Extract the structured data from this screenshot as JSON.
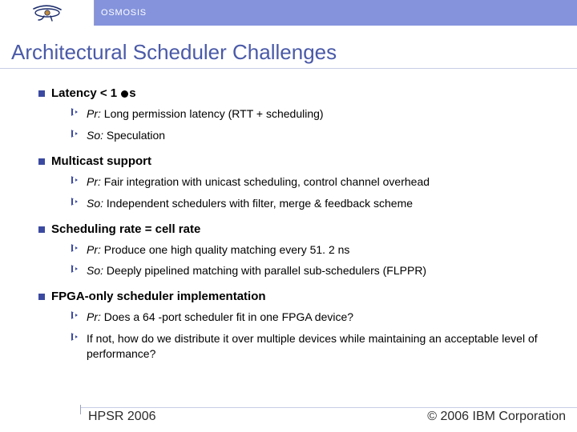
{
  "header": {
    "brand": "OSMOSIS"
  },
  "title": "Architectural Scheduler Challenges",
  "bullets": [
    {
      "head_prefix": "Latency < 1 ",
      "head_suffix": "s",
      "subs": [
        {
          "label": "Pr:",
          "text": "Long permission latency (RTT + scheduling)"
        },
        {
          "label": "So:",
          "text": "Speculation"
        }
      ]
    },
    {
      "head": "Multicast support",
      "subs": [
        {
          "label": "Pr:",
          "text": "Fair integration with unicast scheduling, control channel overhead"
        },
        {
          "label": "So:",
          "text": "Independent schedulers with filter, merge & feedback scheme"
        }
      ]
    },
    {
      "head": "Scheduling rate = cell rate",
      "subs": [
        {
          "label": "Pr:",
          "text": "Produce one high quality matching every 51. 2 ns"
        },
        {
          "label": "So:",
          "text": "Deeply pipelined matching with parallel sub-schedulers (FLPPR)"
        }
      ]
    },
    {
      "head": "FPGA-only scheduler implementation",
      "subs": [
        {
          "label": "Pr:",
          "text": "Does a 64 -port scheduler fit in one FPGA device?"
        },
        {
          "label": "",
          "text": "If not, how do we distribute it over multiple devices while maintaining an acceptable level of performance?"
        }
      ]
    }
  ],
  "footer": {
    "left": "HPSR 2006",
    "right": "© 2006 IBM Corporation"
  }
}
